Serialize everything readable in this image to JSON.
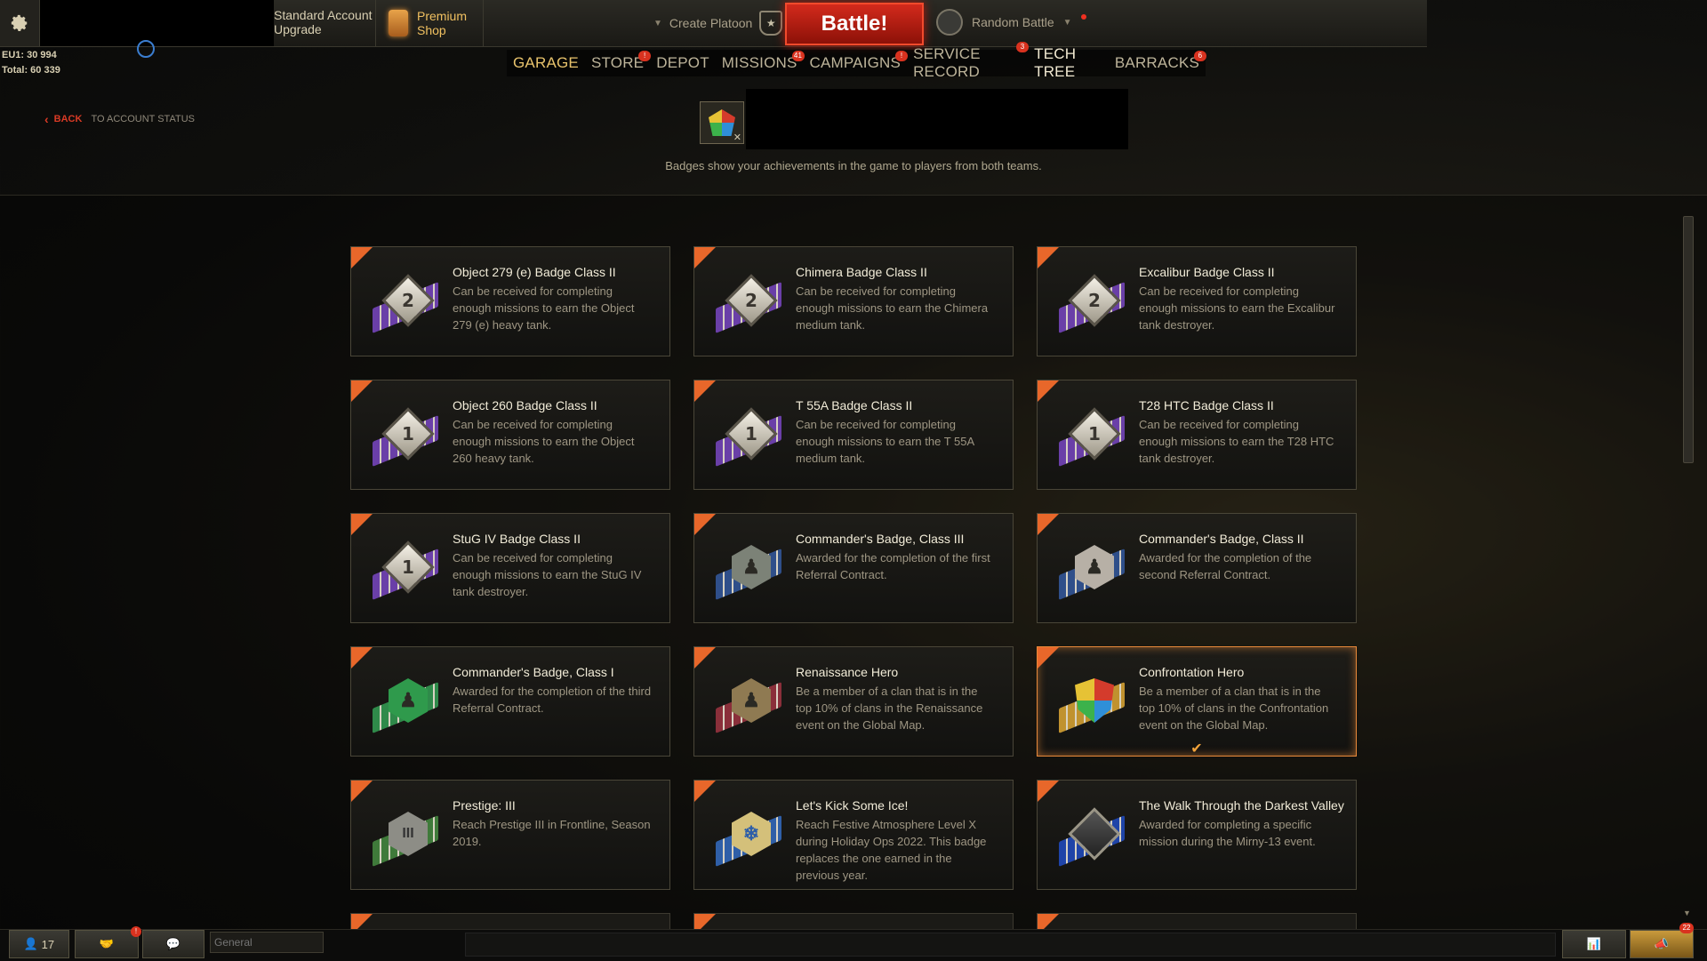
{
  "topbar": {
    "account_line1": "Standard Account",
    "account_line2": "Upgrade",
    "premium_line1": "Premium",
    "premium_line2": "Shop",
    "create_platoon": "Create Platoon",
    "battle": "Battle!",
    "mode": "Random Battle"
  },
  "stats": {
    "line1": "EU1: 30 994",
    "line2": "Total: 60 339"
  },
  "nav": [
    {
      "label": "GARAGE",
      "badge": ""
    },
    {
      "label": "STORE",
      "badge": "!"
    },
    {
      "label": "DEPOT",
      "badge": ""
    },
    {
      "label": "MISSIONS",
      "badge": "41"
    },
    {
      "label": "CAMPAIGNS",
      "badge": "!"
    },
    {
      "label": "SERVICE RECORD",
      "badge": "3"
    },
    {
      "label": "TECH TREE",
      "badge": ""
    },
    {
      "label": "BARRACKS",
      "badge": "6"
    }
  ],
  "back": {
    "label": "BACK",
    "sub": "TO ACCOUNT STATUS"
  },
  "caption": "Badges show your achievements in the game to players from both teams.",
  "badges": [
    {
      "title": "Object 279 (e) Badge Class II",
      "desc": "Can be received for completing enough missions to earn the Object 279 (e) heavy tank.",
      "emblem": "2",
      "kind": "diamond",
      "ribbon": "#6a3fa8"
    },
    {
      "title": "Chimera Badge Class II",
      "desc": "Can be received for completing enough missions to earn the Chimera medium tank.",
      "emblem": "2",
      "kind": "diamond",
      "ribbon": "#6a3fa8"
    },
    {
      "title": "Excalibur Badge Class II",
      "desc": "Can be received for completing enough missions to earn the Excalibur tank destroyer.",
      "emblem": "2",
      "kind": "diamond",
      "ribbon": "#6a3fa8"
    },
    {
      "title": "Object 260 Badge Class II",
      "desc": "Can be received for completing enough missions to earn the Object 260 heavy tank.",
      "emblem": "1",
      "kind": "diamond",
      "ribbon": "#6a3fa8"
    },
    {
      "title": "T 55A Badge Class II",
      "desc": "Can be received for completing enough missions to earn the T 55A medium tank.",
      "emblem": "1",
      "kind": "diamond",
      "ribbon": "#6a3fa8"
    },
    {
      "title": "T28 HTC Badge Class II",
      "desc": "Can be received for completing enough missions to earn the T28 HTC tank destroyer.",
      "emblem": "1",
      "kind": "diamond",
      "ribbon": "#6a3fa8"
    },
    {
      "title": "StuG IV Badge Class II",
      "desc": "Can be received for completing enough missions to earn the StuG IV tank destroyer.",
      "emblem": "1",
      "kind": "diamond",
      "ribbon": "#6a3fa8"
    },
    {
      "title": "Commander's Badge, Class III",
      "desc": "Awarded for the completion of the first Referral Contract.",
      "emblem": "",
      "kind": "hex",
      "ribbon": "#2f4f8a",
      "fill": "#7c8277"
    },
    {
      "title": "Commander's Badge, Class II",
      "desc": "Awarded for the completion of the second Referral Contract.",
      "emblem": "",
      "kind": "hex",
      "ribbon": "#2f4f8a",
      "fill": "#b7b0a6"
    },
    {
      "title": "Commander's Badge, Class I",
      "desc": "Awarded for the completion of the third Referral Contract.",
      "emblem": "",
      "kind": "hex",
      "ribbon": "#2f8a4a",
      "fill": "#2f9a4c"
    },
    {
      "title": "Renaissance Hero",
      "desc": "Be a member of a clan that is in the top 10% of clans in the Renaissance event on the Global Map.",
      "emblem": "",
      "kind": "hex",
      "ribbon": "#8a2f3a",
      "fill": "#8f7a52"
    },
    {
      "title": "Confrontation Hero",
      "desc": "Be a member of a clan that is in the top 10% of clans in the Confrontation event on the Global Map.",
      "emblem": "",
      "kind": "shield",
      "ribbon": "#c0922f",
      "fill": "conic",
      "selected": true
    },
    {
      "title": "Prestige: III",
      "desc": "Reach Prestige III in Frontline, Season 2019.",
      "emblem": "III",
      "kind": "hex",
      "ribbon": "#3f7a3a",
      "fill": "#8d8d86"
    },
    {
      "title": "Let's Kick Some Ice!",
      "desc": "Reach Festive Atmosphere Level X during Holiday Ops 2022. This badge replaces the one earned in the previous year.",
      "emblem": "",
      "kind": "snow",
      "ribbon": "#2f5fa8",
      "fill": "#d4c07a"
    },
    {
      "title": "The Walk Through the Darkest Valley",
      "desc": "Awarded for completing a specific mission during the Mirny-13 event.",
      "emblem": "",
      "kind": "diamond-dark",
      "ribbon": "#1f44a8",
      "fill": "#333"
    }
  ],
  "bottombar": {
    "players": "17",
    "chat_placeholder": "General",
    "notif_badge": "22",
    "contacts_badge": "!"
  }
}
